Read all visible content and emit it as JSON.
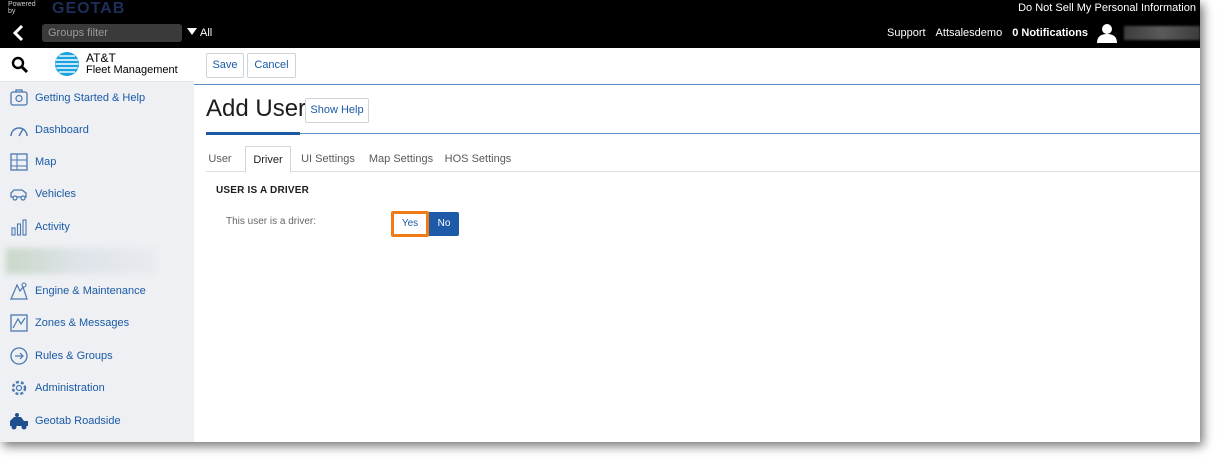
{
  "topbar": {
    "powered_by": "Powered by",
    "brand": "GEOTAB",
    "do_not_sell": "Do Not Sell My Personal Information",
    "groups_filter_placeholder": "Groups filter",
    "groups_scope": "All",
    "support": "Support",
    "account": "Attsalesdemo",
    "notifications": "0 Notifications"
  },
  "sidebar": {
    "logo_line1": "AT&T",
    "logo_line2": "Fleet Management",
    "items": [
      {
        "label": "Getting Started & Help",
        "icon": "help-icon"
      },
      {
        "label": "Dashboard",
        "icon": "dashboard-icon"
      },
      {
        "label": "Map",
        "icon": "map-icon"
      },
      {
        "label": "Vehicles",
        "icon": "vehicle-icon"
      },
      {
        "label": "Activity",
        "icon": "activity-icon"
      },
      {
        "label": "Engine & Maintenance",
        "icon": "engine-icon"
      },
      {
        "label": "Zones & Messages",
        "icon": "zones-icon"
      },
      {
        "label": "Rules & Groups",
        "icon": "rules-icon"
      },
      {
        "label": "Administration",
        "icon": "gear-icon"
      },
      {
        "label": "Geotab Roadside",
        "icon": "roadside-icon"
      }
    ]
  },
  "toolbar": {
    "save_label": "Save",
    "cancel_label": "Cancel"
  },
  "page": {
    "title": "Add User",
    "show_help_label": "Show Help",
    "tabs": [
      {
        "label": "User",
        "active": false
      },
      {
        "label": "Driver",
        "active": true
      },
      {
        "label": "UI Settings",
        "active": false
      },
      {
        "label": "Map Settings",
        "active": false
      },
      {
        "label": "HOS Settings",
        "active": false
      }
    ],
    "section_heading": "USER IS A DRIVER",
    "driver_field_label": "This user is a driver:",
    "yes_label": "Yes",
    "no_label": "No",
    "selected": "No"
  },
  "colors": {
    "accent": "#1d5ba8",
    "link": "#1a5aa6",
    "highlight": "#f07b18",
    "sidebar_bg": "#eef0f3"
  }
}
